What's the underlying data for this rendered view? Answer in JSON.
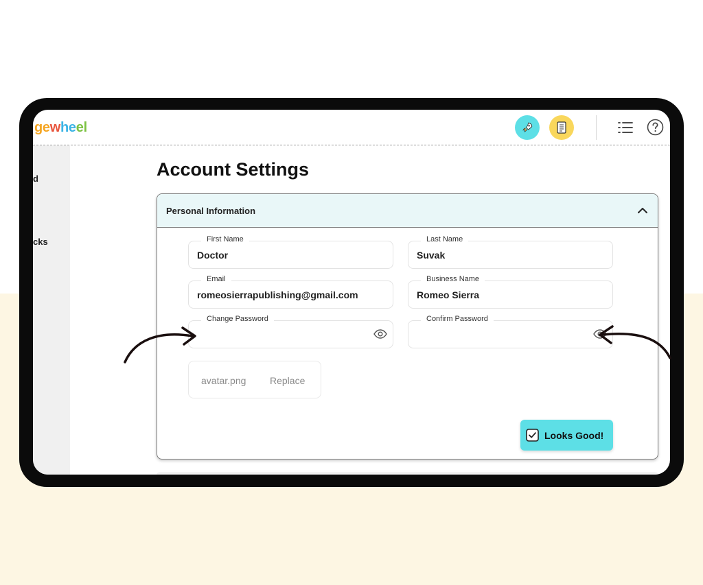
{
  "app": {
    "logo_parts": [
      "ge",
      "w",
      "he",
      "el"
    ],
    "brand_colors": {
      "orange": "#f5a623",
      "red": "#e8553d",
      "blue": "#3cb4e5",
      "green": "#7cc242"
    }
  },
  "header": {
    "icons": [
      "rocket-icon",
      "notes-icon",
      "menu-icon",
      "help-icon"
    ],
    "rocket_color": "#5ddfe6",
    "notes_color": "#f9d75c"
  },
  "sidebar": {
    "items": [
      {
        "label": "d"
      },
      {
        "label": "cks"
      }
    ]
  },
  "page": {
    "title": "Account Settings"
  },
  "personal_info": {
    "title": "Personal Information",
    "fields": {
      "first_name": {
        "label": "First Name",
        "value": "Doctor"
      },
      "last_name": {
        "label": "Last Name",
        "value": "Suvak"
      },
      "email": {
        "label": "Email",
        "value": "romeosierrapublishing@gmail.com"
      },
      "business_name": {
        "label": "Business Name",
        "value": "Romeo Sierra"
      },
      "change_password": {
        "label": "Change Password",
        "value": ""
      },
      "confirm_password": {
        "label": "Confirm Password",
        "value": ""
      }
    },
    "avatar": {
      "file": "avatar.png",
      "replace_label": "Replace"
    },
    "confirm_button": {
      "label": "Looks Good!",
      "color": "#5ddfe6"
    }
  }
}
